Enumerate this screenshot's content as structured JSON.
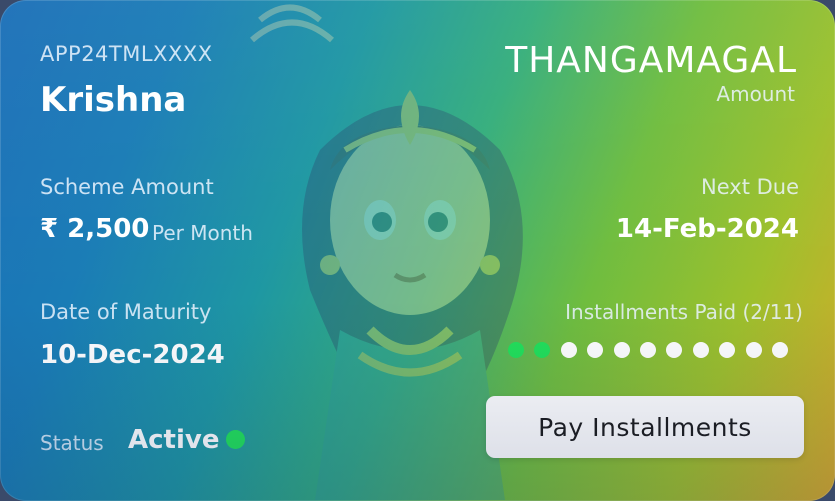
{
  "card": {
    "app_id": "APP24TMLXXXX",
    "customer_name": "Krishna",
    "brand": "THANGAMAGAL",
    "brand_sub": "Amount",
    "scheme": {
      "label": "Scheme Amount",
      "amount": "₹ 2,500",
      "period": "Per Month"
    },
    "next_due": {
      "label": "Next Due",
      "date": "14-Feb-2024"
    },
    "maturity": {
      "label": "Date of Maturity",
      "date": "10-Dec-2024"
    },
    "installments": {
      "label": "Installments Paid (2/11)",
      "paid": 2,
      "total": 11
    },
    "status": {
      "label": "Status",
      "value": "Active"
    },
    "pay_button": "Pay Installments"
  },
  "colors": {
    "paid_dot": "#22e05a",
    "unpaid_dot": "#ffffff",
    "active_dot": "#22e05a"
  },
  "icons": {
    "illustration": "woman-with-jewelry-illustration",
    "status_indicator": "green-dot-icon"
  }
}
